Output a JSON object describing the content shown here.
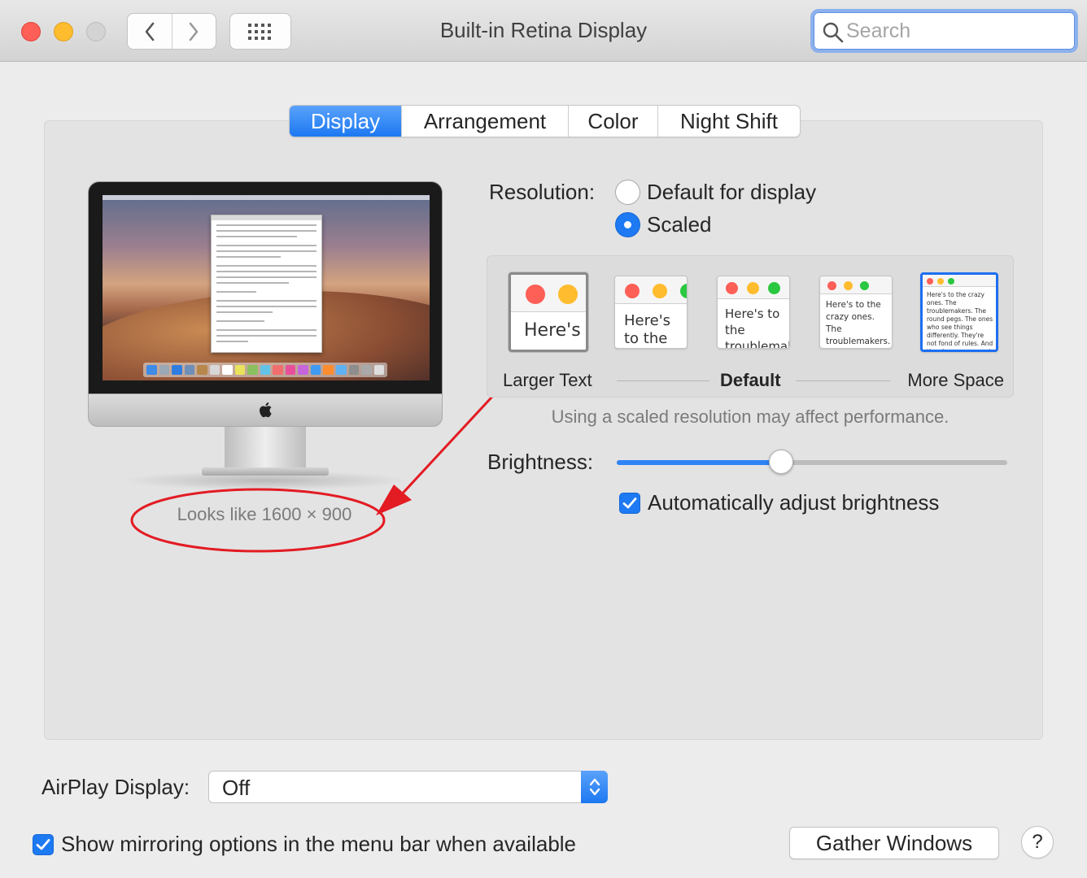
{
  "window": {
    "title": "Built-in Retina Display",
    "search_placeholder": "Search"
  },
  "tabs": [
    {
      "label": "Display",
      "active": true
    },
    {
      "label": "Arrangement",
      "active": false
    },
    {
      "label": "Color",
      "active": false
    },
    {
      "label": "Night Shift",
      "active": false
    }
  ],
  "preview": {
    "looks_like": "Looks like 1600 × 900",
    "annotation_color": "#e31b23"
  },
  "resolution": {
    "label": "Resolution:",
    "options": [
      {
        "label": "Default for display",
        "selected": false
      },
      {
        "label": "Scaled",
        "selected": true
      }
    ],
    "scale_options": [
      {
        "sample_text": "Here's",
        "selected": false
      },
      {
        "sample_text": "Here's to the troublemakers",
        "selected": false
      },
      {
        "sample_text": "Here's to the troublemakers. The ones who",
        "selected": false
      },
      {
        "sample_text": "Here's to the crazy ones. The troublemakers. The ones who see things differently. They're not fond of rules. And they",
        "selected": false
      },
      {
        "sample_text": "Here's to the crazy ones. The troublemakers. The round pegs. The ones who see things differently. They're not fond of rules. And they have no respect. You can quote them, disagree with them. About the only thing you can't do is ignore them. Because they change things.",
        "selected": true
      }
    ],
    "scale_labels": {
      "larger": "Larger Text",
      "default": "Default",
      "more": "More Space"
    },
    "note": "Using a scaled resolution may affect performance."
  },
  "brightness": {
    "label": "Brightness:",
    "level": 0.42,
    "auto_label": "Automatically adjust brightness",
    "auto_checked": true
  },
  "airplay": {
    "label": "AirPlay Display:",
    "value": "Off"
  },
  "mirroring": {
    "label": "Show mirroring options in the menu bar when available",
    "checked": true
  },
  "buttons": {
    "gather": "Gather Windows",
    "help": "?"
  },
  "colors": {
    "accent": "#1d7af2",
    "close": "#fe5f57",
    "minimize": "#febc2e"
  }
}
